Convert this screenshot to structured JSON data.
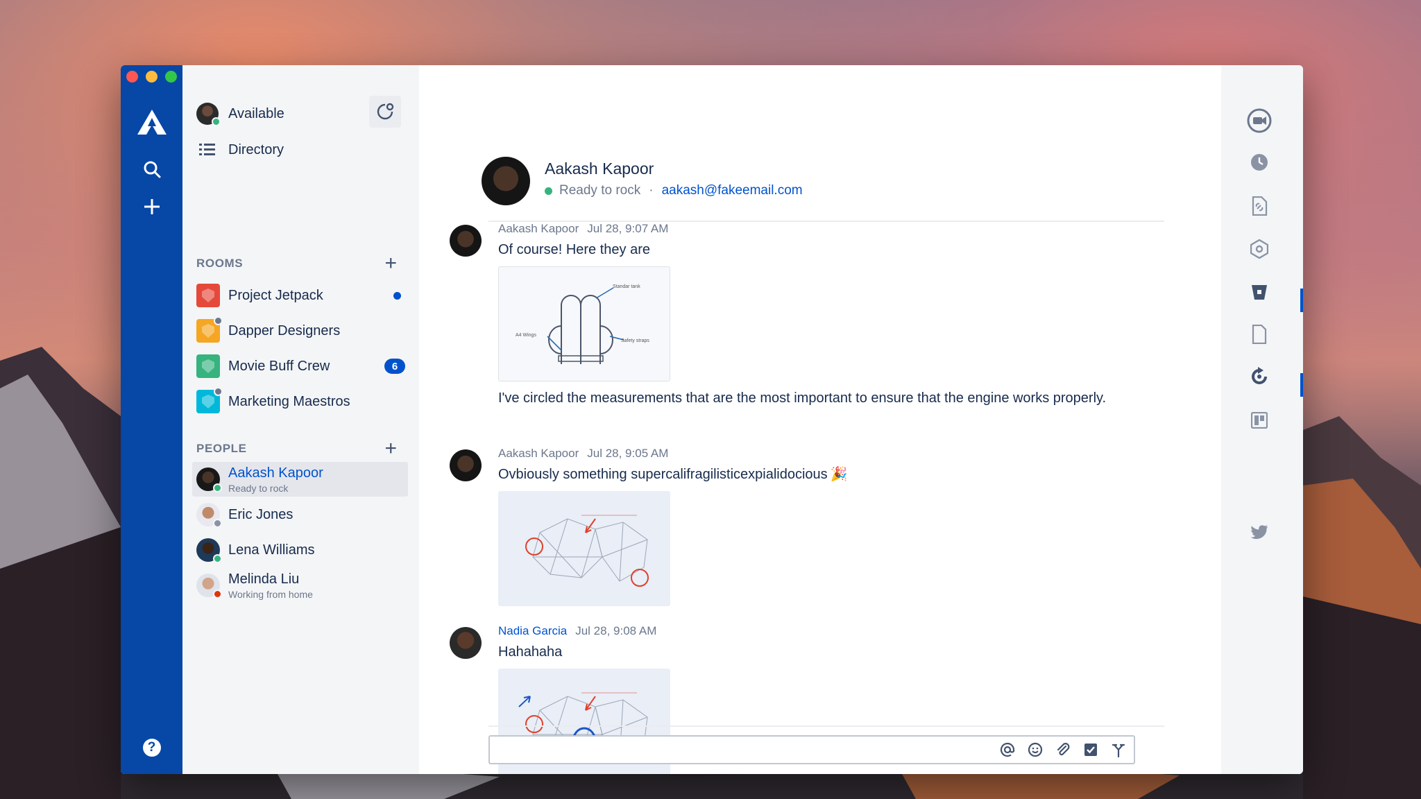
{
  "app": {
    "help_label": "?"
  },
  "sidebar": {
    "status_label": "Available",
    "directory_label": "Directory",
    "rooms_title": "ROOMS",
    "rooms": [
      {
        "name": "Project Jetpack",
        "color": "#e5493a",
        "unread_dot": true,
        "count": ""
      },
      {
        "name": "Dapper Designers",
        "color": "#f5a623",
        "unread_dot": false,
        "count": ""
      },
      {
        "name": "Movie Buff Crew",
        "color": "#36b37e",
        "unread_dot": false,
        "count": "6"
      },
      {
        "name": "Marketing Maestros",
        "color": "#00b8d9",
        "unread_dot": false,
        "count": ""
      }
    ],
    "people_title": "PEOPLE",
    "people": [
      {
        "name": "Aakash Kapoor",
        "status": "Ready to rock",
        "presence": "online",
        "selected": true
      },
      {
        "name": "Eric Jones",
        "status": "",
        "presence": "away",
        "selected": false
      },
      {
        "name": "Lena Williams",
        "status": "",
        "presence": "online",
        "selected": false
      },
      {
        "name": "Melinda Liu",
        "status": "Working from home",
        "presence": "busy",
        "selected": false
      }
    ]
  },
  "conversation": {
    "header": {
      "name": "Aakash Kapoor",
      "status": "Ready to rock",
      "separator": "·",
      "email": "aakash@fakeemail.com"
    },
    "messages": [
      {
        "author": "Aakash Kapoor",
        "time": "Jul 28, 9:07 AM",
        "text": "Of course! Here they are",
        "after_text": "I've circled the measurements that are the most important to ensure that the engine works properly.",
        "attachment": "jetpack-sketch",
        "sketch_labels": [
          "Standar tank",
          "A4 Wings",
          "Safety straps"
        ]
      },
      {
        "author": "Aakash Kapoor",
        "time": "Jul 28, 9:05 AM",
        "text": "Ovbiously something supercalifragilisticexpialidocious",
        "emoji": "🎉",
        "attachment": "engine-sketch"
      },
      {
        "author": "Nadia Garcia",
        "author_color": "#0052cc",
        "time": "Jul 28, 9:08 AM",
        "text": "Hahahaha",
        "attachment": "engine-sketch-annotated"
      }
    ]
  },
  "composer": {
    "value": "",
    "placeholder": ""
  },
  "colors": {
    "app_bar": "#0747a6",
    "accent": "#0052cc",
    "text": "#172b4d",
    "muted": "#6b778c"
  }
}
